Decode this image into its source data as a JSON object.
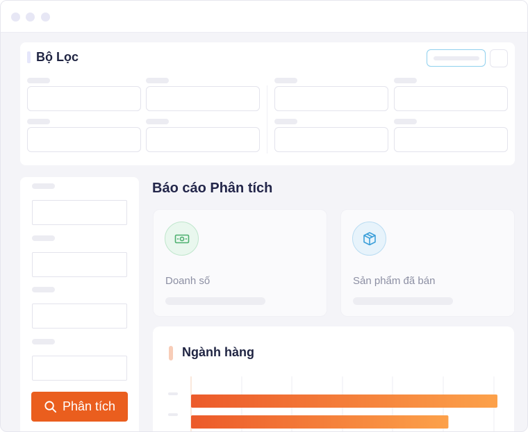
{
  "window": {
    "controls": [
      "dot",
      "dot",
      "dot"
    ]
  },
  "filter": {
    "title": "Bộ Lọc",
    "fields": 8
  },
  "sidebar": {
    "fields": 4,
    "analyze_label": "Phân tích"
  },
  "report": {
    "title": "Báo cáo Phân tích",
    "stats": [
      {
        "label": "Doanh số",
        "icon": "money-icon",
        "color": "#4caf6e",
        "bg": "#e9f7ee"
      },
      {
        "label": "Sản phẩm đã bán",
        "icon": "box-icon",
        "color": "#3b9fd9",
        "bg": "#e7f3fb"
      }
    ]
  },
  "chart_data": {
    "type": "bar",
    "title": "Ngành hàng",
    "orientation": "horizontal",
    "series": [
      {
        "values": [
          100,
          84
        ]
      }
    ],
    "xlim": [
      0,
      100
    ],
    "grid": true,
    "colors": [
      "#ec5a2a",
      "#fca14a"
    ]
  }
}
